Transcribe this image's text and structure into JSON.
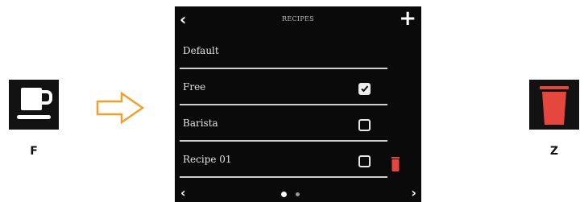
{
  "left_key": {
    "icon": "coffee-cup-icon",
    "caption": "F"
  },
  "flow_arrow": {
    "icon": "arrow-right-outline-icon",
    "color": "#f0a030"
  },
  "screen": {
    "title": "RECIPES",
    "back_icon": "‹",
    "add_icon": "+",
    "rows": [
      {
        "label": "Default"
      },
      {
        "label": "Free",
        "checked": true
      },
      {
        "label": "Barista",
        "checked": false
      },
      {
        "label": "Recipe 01",
        "checked": false,
        "deletable": true
      }
    ],
    "prev_icon": "‹",
    "next_icon": "›",
    "page_dots": {
      "current": 1,
      "total": 2
    }
  },
  "right_key": {
    "icon": "trash-icon",
    "caption": "Z",
    "color": "#e5473f"
  }
}
